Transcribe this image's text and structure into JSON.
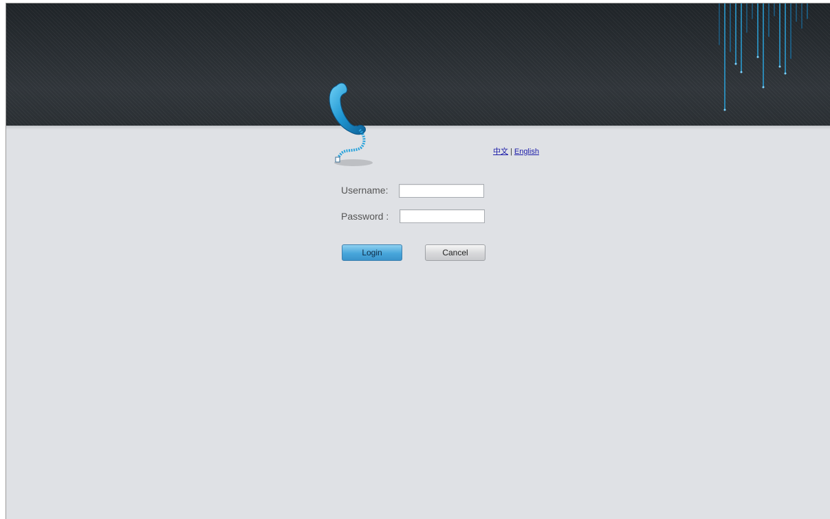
{
  "header": {
    "logo_icon": "telephone-handset-icon",
    "accent_color": "#2aa3dc"
  },
  "language": {
    "chinese_label": "中文",
    "separator": "|",
    "english_label": "English"
  },
  "form": {
    "username_label": "Username:",
    "username_value": "",
    "password_label": "Password :",
    "password_value": "",
    "login_label": "Login",
    "cancel_label": "Cancel"
  }
}
